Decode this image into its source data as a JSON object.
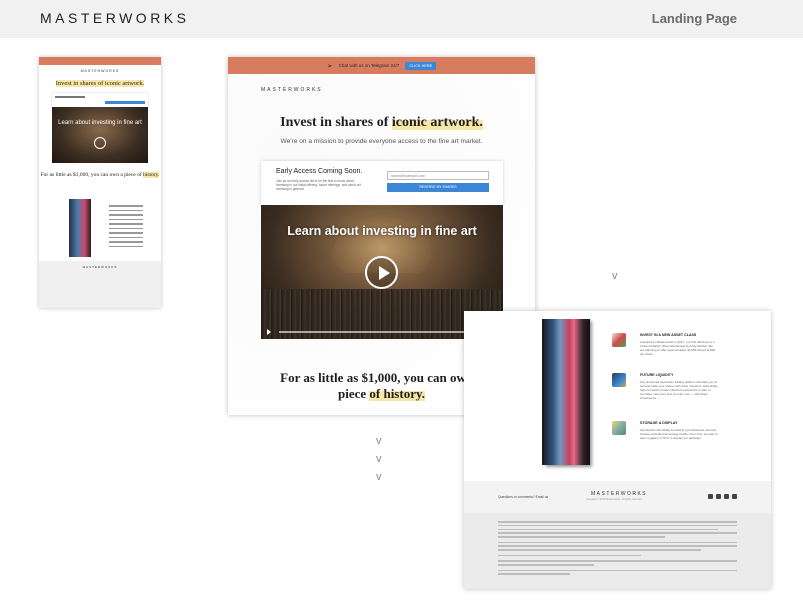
{
  "header": {
    "brand": "MASTERWORKS",
    "page_title": "Landing Page"
  },
  "thumbnail": {
    "logo": "MASTERWORKS",
    "headline_pre": "Invest in shares of ",
    "headline_hl": "iconic artwork.",
    "video_title": "Learn about investing in fine art",
    "headline2_pre": "For as little as $1,000, you can own a piece of ",
    "headline2_hl": "history."
  },
  "main_preview": {
    "telegram_text": "Chat with us on Telegram 24/7",
    "telegram_button": "CLICK HERE",
    "logo": "MASTERWORKS",
    "headline_pre": "Invest in shares of ",
    "headline_hl": "iconic artwork.",
    "subheadline": "We're on a mission to provide everyone access to the fine art market.",
    "card_title": "Early Access Coming Soon.",
    "card_text": "Join as an early access list to be the first to know about investing in our initial offering, future offerings, and about art investing in general.",
    "email_placeholder": "name@example.com",
    "reserve_button": "RESERVE MY SHARES",
    "video_title": "Learn about investing in fine art",
    "headline2_pre": "For as little as $1,000, you can own a",
    "headline2_mid": "piece ",
    "headline2_hl": "of history."
  },
  "detail_preview": {
    "features": [
      {
        "title": "INVEST IN A NEW ASSET CLASS",
        "desc": "Acquired by Masterworks in 2017, our first offering is a 1 Colored Marilyn (Reversal Series) by Andy Warhol. We are planning to offer approximately 40,000 shares at $20 per share."
      },
      {
        "title": "FUTURE LIQUIDITY",
        "desc": "Our pioneered secondary trading platform will allow you to sell and trade your shares with other investors. Historically, high net worth private collectors sold works to offer to purchase new ones and you can now — with direct investments — ..."
      },
      {
        "title": "STORAGE & DISPLAY",
        "desc": "All artworks will initially be held in a professional, secured, climate-controlled art storage facility. Over time, we plan to open a gallery in NYC to display our paintings."
      }
    ],
    "footer_question": "Questions or comments? Email us",
    "footer_logo": "MASTERWORKS",
    "footer_sub": "Copyright © 2018 Masterworks. All rights reserved."
  },
  "colors": {
    "accent_bar": "#d77c5f",
    "button_blue": "#3b87d6",
    "highlight": "#f6e7a6"
  },
  "chevrons": [
    "v",
    "v",
    "v",
    "v"
  ]
}
